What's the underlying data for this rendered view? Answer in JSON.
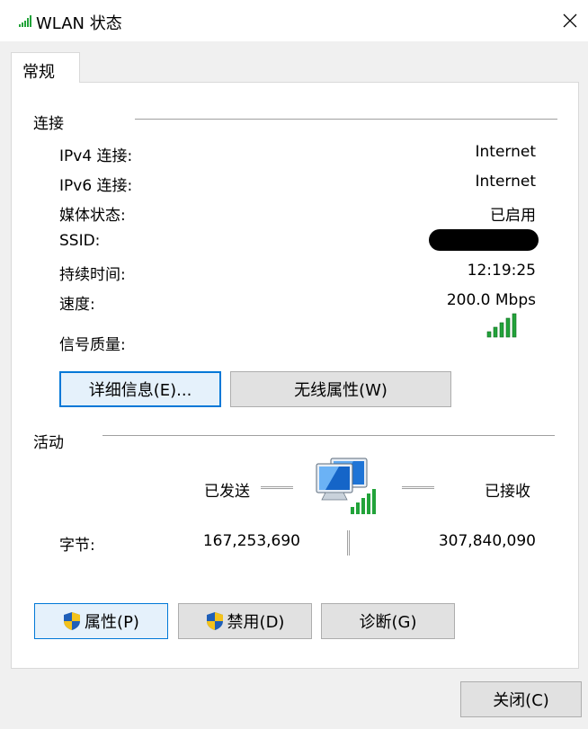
{
  "window": {
    "title": "WLAN 状态",
    "icon": "wifi-signal-icon"
  },
  "tabs": [
    {
      "label": "常规",
      "selected": true
    }
  ],
  "connection": {
    "group_label": "连接",
    "rows": [
      {
        "label": "IPv4 连接:",
        "value": "Internet"
      },
      {
        "label": "IPv6 连接:",
        "value": "Internet"
      },
      {
        "label": "媒体状态:",
        "value": "已启用"
      },
      {
        "label": "SSID:",
        "value": "",
        "redacted": true
      },
      {
        "label": "持续时间:",
        "value": "12:19:25"
      },
      {
        "label": "速度:",
        "value": "200.0 Mbps"
      }
    ],
    "signal_label": "信号质量:",
    "signal_bars": 5,
    "signal_icon": "signal-strength-icon",
    "details_button": "详细信息(E)...",
    "wireless_props_button": "无线属性(W)"
  },
  "activity": {
    "group_label": "活动",
    "sent_label": "已发送",
    "received_label": "已接收",
    "bytes_label": "字节:",
    "bytes_sent": "167,253,690",
    "bytes_received": "307,840,090",
    "icon": "network-computers-icon"
  },
  "actions": {
    "properties": "属性(P)",
    "disable": "禁用(D)",
    "diagnose": "诊断(G)",
    "shield_icon": "uac-shield-icon"
  },
  "footer": {
    "close": "关闭(C)"
  },
  "colors": {
    "accent": "#0078d7",
    "signal": "#22a33a"
  }
}
